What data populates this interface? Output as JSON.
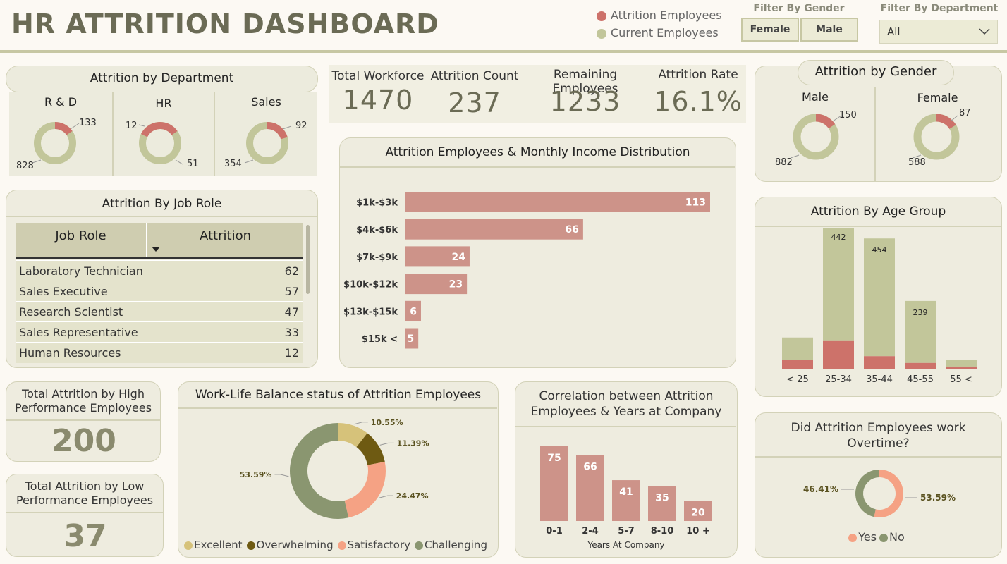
{
  "header": {
    "title": "HR ATTRITION DASHBOARD",
    "legend": [
      {
        "label": "Attrition Employees",
        "color": "#cd726a"
      },
      {
        "label": "Current Employees",
        "color": "#c2c69a"
      }
    ],
    "filter_gender_label": "Filter By Gender",
    "gender_buttons": [
      "Female",
      "Male"
    ],
    "filter_dept_label": "Filter By Department",
    "dept_selected": "All"
  },
  "kpis": {
    "total_workforce_label": "Total Workforce",
    "total_workforce": "1470",
    "attrition_count_label": "Attrition Count",
    "attrition_count": "237",
    "remaining_label": "Remaining Employees",
    "remaining": "1233",
    "attrition_rate_label": "Attrition Rate",
    "attrition_rate": "16.1%"
  },
  "department": {
    "title": "Attrition by Department",
    "items": [
      {
        "name": "R & D",
        "attrition": "133",
        "current": "828"
      },
      {
        "name": "HR",
        "attrition": "12",
        "current": "51"
      },
      {
        "name": "Sales",
        "attrition": "92",
        "current": "354"
      }
    ]
  },
  "gender": {
    "title": "Attrition by Gender",
    "items": [
      {
        "name": "Male",
        "attrition": "150",
        "current": "882"
      },
      {
        "name": "Female",
        "attrition": "87",
        "current": "588"
      }
    ]
  },
  "job_role": {
    "title": "Attrition By Job Role",
    "col_role": "Job Role",
    "col_attrition": "Attrition",
    "rows": [
      {
        "role": "Laboratory Technician",
        "value": "62"
      },
      {
        "role": "Sales Executive",
        "value": "57"
      },
      {
        "role": "Research Scientist",
        "value": "47"
      },
      {
        "role": "Sales Representative",
        "value": "33"
      },
      {
        "role": "Human Resources",
        "value": "12"
      }
    ]
  },
  "high_perf": {
    "title": "Total Attrition by High Performance Employees",
    "value": "200"
  },
  "low_perf": {
    "title": "Total Attrition by Low Performance Employees",
    "value": "37"
  },
  "income": {
    "title": "Attrition Employees & Monthly Income Distribution"
  },
  "age": {
    "title": "Attrition By Age Group"
  },
  "worklife": {
    "title": "Work-Life Balance status of Attrition Employees"
  },
  "years": {
    "title": "Correlation between Attrition Employees & Years at Company"
  },
  "overtime": {
    "title": "Did Attrition Employees work Overtime?"
  },
  "chart_data": [
    {
      "type": "bar",
      "orientation": "horizontal",
      "title": "Attrition Employees & Monthly Income Distribution",
      "categories": [
        "$1k-$3k",
        "$4k-$6k",
        "$7k-$9k",
        "$10k-$12k",
        "$13k-$15k",
        "$15k <"
      ],
      "values": [
        113,
        66,
        24,
        23,
        6,
        5
      ],
      "color": "#cd9389"
    },
    {
      "type": "bar",
      "stacked": true,
      "title": "Attrition By Age Group",
      "categories": [
        "< 25",
        "25-34",
        "35-44",
        "45-55",
        "55 <"
      ],
      "series": [
        {
          "name": "Attrition Employees",
          "values": [
            38,
            112,
            51,
            25,
            11
          ],
          "color": "#cd726a"
        },
        {
          "name": "Current Employees",
          "values": [
            85,
            442,
            454,
            239,
            26
          ],
          "color": "#c2c69a"
        }
      ],
      "labels_shown": [
        "",
        "442",
        "454",
        "239",
        ""
      ]
    },
    {
      "type": "pie",
      "donut": true,
      "title": "Work-Life Balance status of Attrition Employees",
      "categories": [
        "Excellent",
        "Overwhelming",
        "Satisfactory",
        "Challenging"
      ],
      "values": [
        10.55,
        11.39,
        24.47,
        53.59
      ],
      "value_labels": [
        "10.55%",
        "11.39%",
        "24.47%",
        "53.59%"
      ],
      "colors": [
        "#d6c27a",
        "#6e5a12",
        "#f5a284",
        "#8a9670"
      ]
    },
    {
      "type": "bar",
      "title": "Correlation between Attrition Employees & Years at Company",
      "xlabel": "Years At Company",
      "categories": [
        "0-1",
        "2-4",
        "5-7",
        "8-10",
        "10 +"
      ],
      "values": [
        75,
        66,
        41,
        35,
        20
      ],
      "color": "#cd9389"
    },
    {
      "type": "pie",
      "donut": true,
      "title": "Did Attrition Employees work Overtime?",
      "categories": [
        "Yes",
        "No"
      ],
      "values": [
        53.59,
        46.41
      ],
      "value_labels": [
        "53.59%",
        "46.41%"
      ],
      "colors": [
        "#f5a284",
        "#8a9670"
      ]
    }
  ]
}
